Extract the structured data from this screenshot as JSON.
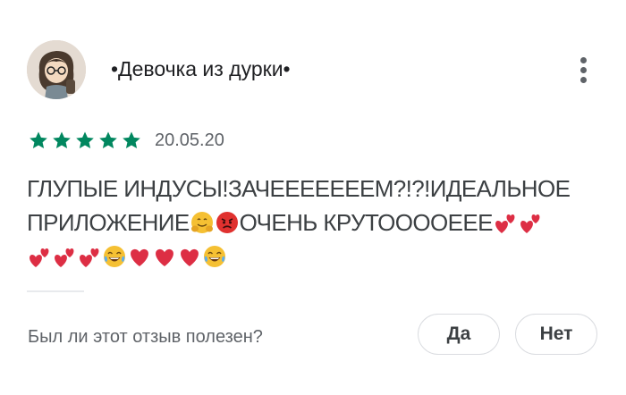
{
  "review": {
    "author": "•Девочка из дурки•",
    "rating": 5,
    "rating_max": 5,
    "date": "20.05.20",
    "text_line1": "ГЛУПЫЕ ИНДУСЫ!ЗАЧЕЕЕЕЕЕЕМ?!?!ИДЕАЛЬНОЕ",
    "text_line2_a": "ПРИЛОЖЕНИЕ",
    "text_line2_b": "ОЧЕНЬ КРУТООООЕЕЕ",
    "emoji": [
      "hugging-face",
      "angry-face",
      "two-hearts",
      "two-hearts",
      "two-hearts",
      "two-hearts",
      "two-hearts",
      "tears-of-joy",
      "red-heart",
      "red-heart",
      "red-heart",
      "tears-of-joy"
    ]
  },
  "feedback": {
    "question": "Был ли этот отзыв полезен?",
    "yes_label": "Да",
    "no_label": "Нет"
  },
  "colors": {
    "star": "#01875f",
    "heart": "#dd2e44",
    "divider": "#e8eaed",
    "border": "#dadce0"
  }
}
